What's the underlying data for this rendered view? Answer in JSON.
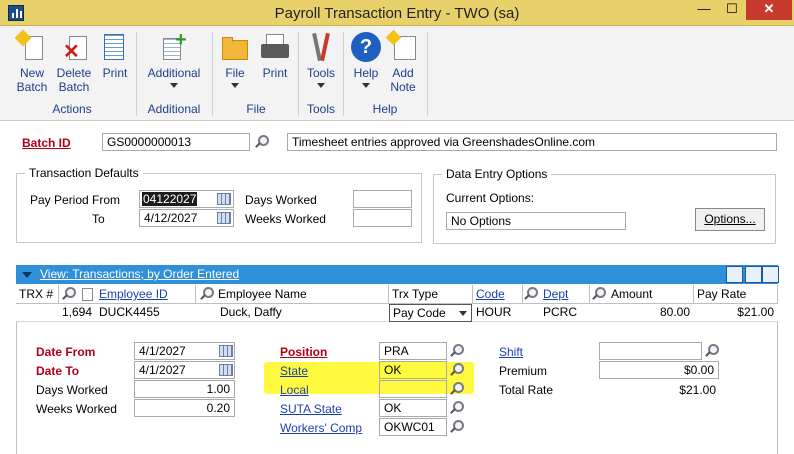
{
  "window": {
    "title": "Payroll Transaction Entry  -  TWO (sa)",
    "min": "—",
    "max": "☐",
    "close": "✕"
  },
  "ribbon": {
    "buttons": [
      {
        "label": "New\nBatch"
      },
      {
        "label": "Delete\nBatch"
      },
      {
        "label": "Print"
      },
      {
        "label": "Additional"
      },
      {
        "label": "File"
      },
      {
        "label": "Print"
      },
      {
        "label": "Tools"
      },
      {
        "label": "Help"
      },
      {
        "label": "Add\nNote"
      }
    ],
    "groups": [
      "Actions",
      "Additional",
      "File",
      "Tools",
      "Help"
    ]
  },
  "batch": {
    "label": "Batch ID",
    "value": "GS0000000013",
    "comment": "Timesheet entries approved via GreenshadesOnline.com"
  },
  "defaults": {
    "caption": "Transaction Defaults",
    "pay_period_from_label": "Pay Period From",
    "pay_period_from": "04122027",
    "to_label": "To",
    "to_value": "4/12/2027",
    "days_worked_label": "Days Worked",
    "weeks_worked_label": "Weeks Worked"
  },
  "options": {
    "caption": "Data Entry Options",
    "current_label": "Current Options:",
    "current_value": "No Options",
    "button": "Options..."
  },
  "grid": {
    "view_label": "View: Transactions; by Order Entered",
    "headers": [
      "TRX #",
      "Employee ID",
      "Employee Name",
      "Trx Type",
      "Code",
      "Dept",
      "Amount",
      "Pay Rate"
    ],
    "row": {
      "trx": "1,694",
      "employee_id": "DUCK4455",
      "employee_name": "Duck, Daffy",
      "trx_type": "Pay Code",
      "code": "HOUR",
      "dept": "PCRC",
      "amount": "80.00",
      "pay_rate": "$21.00"
    }
  },
  "detail": {
    "date_from_label": "Date From",
    "date_from": "4/1/2027",
    "date_to_label": "Date To",
    "date_to": "4/1/2027",
    "days_worked_label": "Days Worked",
    "days_worked": "1.00",
    "weeks_worked_label": "Weeks Worked",
    "weeks_worked": "0.20",
    "position_label": "Position",
    "position": "PRA",
    "state_label": "State",
    "state": "OK",
    "local_label": "Local",
    "local": "",
    "suta_label": "SUTA State",
    "suta": "OK",
    "comp_label": "Workers' Comp",
    "comp": "OKWC01",
    "shift_label": "Shift",
    "shift": "",
    "premium_label": "Premium",
    "premium": "$0.00",
    "total_rate_label": "Total Rate",
    "total_rate": "$21.00"
  },
  "colors": {
    "titlebar": "#e8d06a",
    "gridbar": "#2f8fd8",
    "highlight": "#fffa2a",
    "required": "#b00018"
  }
}
